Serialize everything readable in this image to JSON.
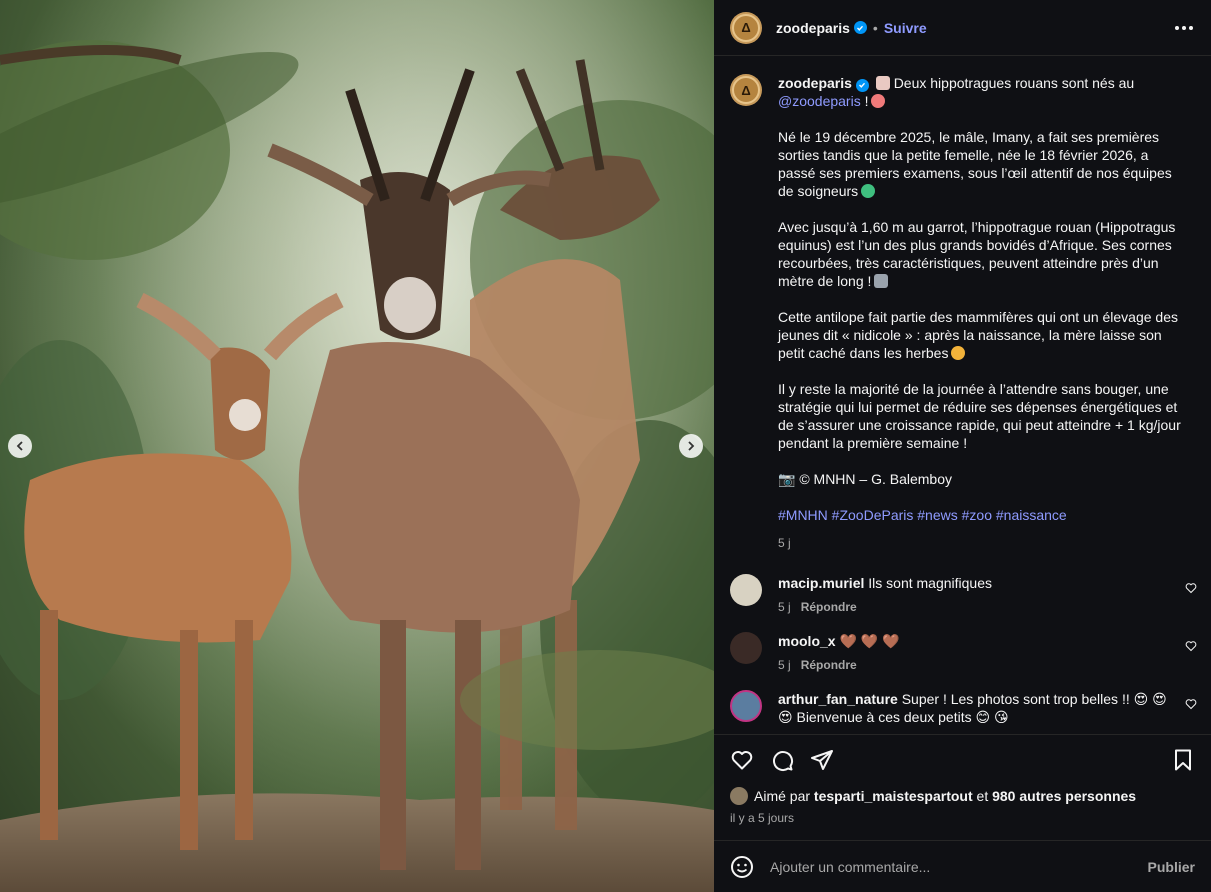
{
  "post": {
    "username": "zoodeparis",
    "follow_label": "Suivre",
    "dot": "•",
    "avatar_letter": "Δ"
  },
  "caption": {
    "username": "zoodeparis",
    "intro_text": "Deux hippotragues rouans sont nés au",
    "mention": "@zoodeparis",
    "intro_end": "!",
    "p1": "Né le 19 décembre 2025, le mâle, Imany, a fait ses premières sorties tandis que la petite femelle, née le 18 février 2026, a passé ses premiers examens, sous l’œil attentif de nos équipes de soigneurs",
    "p2": "Avec jusqu’à 1,60 m au garrot, l’hippotrague rouan (Hippotragus equinus) est l’un des plus grands bovidés d’Afrique. Ses cornes recourbées, très caractéristiques, peuvent atteindre près d’un mètre de long !",
    "p3": "Cette antilope fait partie des mammifères qui ont un élevage des jeunes dit « nidicole » : après la naissance, la mère laisse son petit caché dans les herbes",
    "p4": "Il y reste la majorité de la journée à l’attendre sans bouger, une stratégie qui lui permet de réduire ses dépenses énergétiques et de s’assurer une croissance rapide, qui peut atteindre + 1 kg/jour pendant la première semaine !",
    "credit": "📷 © MNHN – G. Balemboy",
    "hashtags": "#MNHN #ZooDeParis #news #zoo #naissance",
    "time": "5 j"
  },
  "comments": [
    {
      "username": "macip.muriel",
      "text": "Ils sont magnifiques",
      "time": "5 j",
      "reply": "Répondre"
    },
    {
      "username": "moolo_x",
      "text": "🤎 🤎 🤎",
      "time": "5 j",
      "reply": "Répondre"
    },
    {
      "username": "arthur_fan_nature",
      "text": "Super ! Les photos sont trop belles !! 😍 😍 😍 Bienvenue à ces deux petits 😊 😘"
    }
  ],
  "likes": {
    "prefix": "Aimé par",
    "user": "tesparti_maistespartout",
    "middle": "et",
    "others": "980 autres personnes",
    "ago": "il y a 5 jours"
  },
  "add_comment": {
    "placeholder": "Ajouter un commentaire...",
    "publish": "Publier"
  },
  "colors": {
    "accent": "#8f9bff",
    "verified": "#0095f6",
    "panel_bg": "#0f1014",
    "muted": "#a8a8a8"
  },
  "icons": [
    "chevron-left-icon",
    "chevron-right-icon",
    "verified-icon",
    "more-icon",
    "heart-icon",
    "comment-icon",
    "share-icon",
    "bookmark-icon",
    "smile-icon"
  ]
}
